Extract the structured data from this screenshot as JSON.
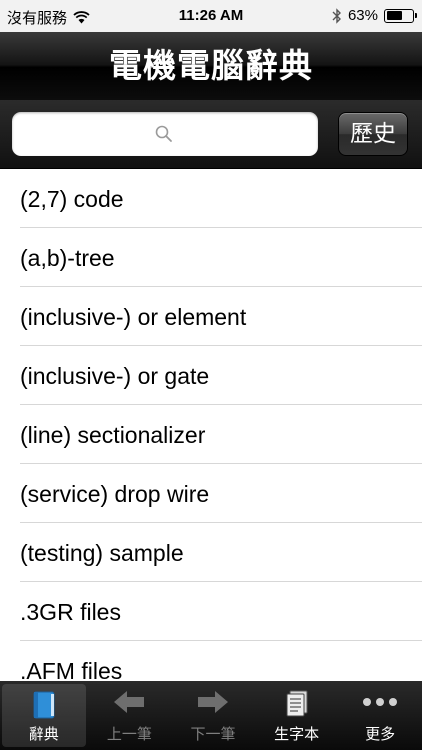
{
  "status_bar": {
    "carrier": "沒有服務",
    "time": "11:26 AM",
    "battery_percent": "63%",
    "battery_level": 0.63
  },
  "header": {
    "title": "電機電腦辭典"
  },
  "search": {
    "placeholder": "",
    "value": "",
    "history_label": "歷史"
  },
  "list": {
    "items": [
      "(2,7) code",
      "(a,b)-tree",
      "(inclusive-) or element",
      "(inclusive-) or gate",
      "(line) sectionalizer",
      "(service) drop wire",
      "(testing) sample",
      ".3GR files",
      ".AFM files"
    ]
  },
  "tab_bar": {
    "tabs": [
      {
        "label": "辭典",
        "icon": "book-icon",
        "state": "active"
      },
      {
        "label": "上一筆",
        "icon": "arrow-left-icon",
        "state": "disabled"
      },
      {
        "label": "下一筆",
        "icon": "arrow-right-icon",
        "state": "disabled"
      },
      {
        "label": "生字本",
        "icon": "notebook-icon",
        "state": "enabled"
      },
      {
        "label": "更多",
        "icon": "more-icon",
        "state": "enabled"
      }
    ]
  },
  "colors": {
    "accent_blue": "#2f8fd8",
    "tab_disabled": "#7f7f7f"
  }
}
